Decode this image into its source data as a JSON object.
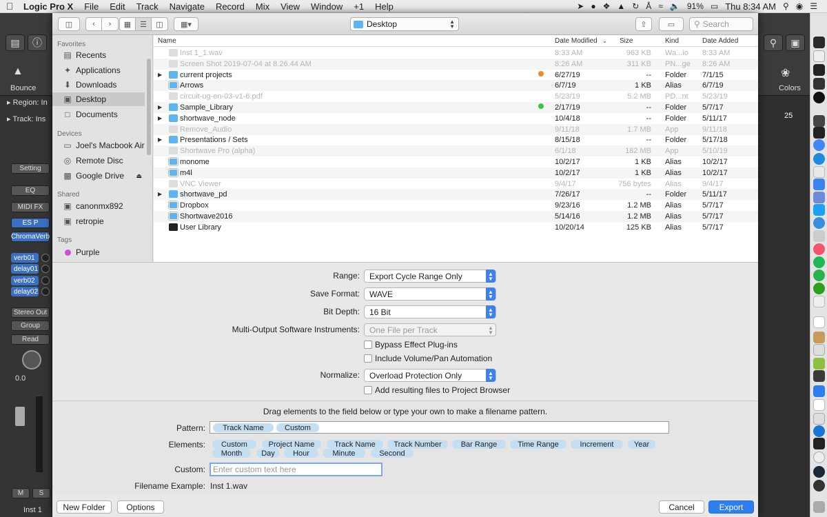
{
  "menubar": {
    "app": "Logic Pro X",
    "menus": [
      "File",
      "Edit",
      "Track",
      "Navigate",
      "Record",
      "Mix",
      "View",
      "Window",
      "+1",
      "Help"
    ],
    "battery": "91%",
    "clock": "Thu 8:34 AM"
  },
  "logic": {
    "bounce_label": "Bounce",
    "colors_label": "Colors",
    "region_label": "Region: In",
    "track_label": "Track: Ins",
    "ruler_value": "25",
    "setting_label": "Setting",
    "eq_label": "EQ",
    "midi_fx_label": "MIDI FX",
    "es_p_label": "ES P",
    "chromaverb_label": "ChromaVerb",
    "sends": [
      "verb01",
      "delay01",
      "verb02",
      "delay02"
    ],
    "stereo_out": "Stereo Out",
    "group_label": "Group",
    "read_label": "Read",
    "volume_value": "0.0",
    "mute_label": "M",
    "solo_label": "S",
    "channel_name": "Inst 1"
  },
  "dialog": {
    "location": "Desktop",
    "search_placeholder": "Search",
    "sidebar": {
      "favorites_header": "Favorites",
      "favorites": [
        {
          "label": "Recents",
          "icon": "recents-icon"
        },
        {
          "label": "Applications",
          "icon": "applications-icon"
        },
        {
          "label": "Downloads",
          "icon": "downloads-icon"
        },
        {
          "label": "Desktop",
          "icon": "desktop-icon"
        },
        {
          "label": "Documents",
          "icon": "documents-icon"
        }
      ],
      "devices_header": "Devices",
      "devices": [
        {
          "label": "Joel's Macbook Air",
          "icon": "laptop-icon"
        },
        {
          "label": "Remote Disc",
          "icon": "disc-icon"
        },
        {
          "label": "Google Drive",
          "icon": "drive-icon"
        }
      ],
      "shared_header": "Shared",
      "shared": [
        {
          "label": "canonmx892",
          "icon": "monitor-icon"
        },
        {
          "label": "retropie",
          "icon": "monitor-icon"
        }
      ],
      "tags_header": "Tags",
      "tags": [
        {
          "label": "Purple",
          "color": "#d14ed6"
        }
      ]
    },
    "columns": {
      "name": "Name",
      "date_modified": "Date Modified",
      "size": "Size",
      "kind": "Kind",
      "date_added": "Date Added"
    },
    "files": [
      {
        "name": "Inst 1_1.wav",
        "date_modified": "8:33 AM",
        "size": "963 KB",
        "kind": "Wa...io",
        "date_added": "8:33 AM",
        "icon": "doc",
        "dim": true
      },
      {
        "name": "Screen Shot 2019-07-04 at 8.26.44 AM",
        "date_modified": "8:26 AM",
        "size": "311 KB",
        "kind": "PN...ge",
        "date_added": "8:26 AM",
        "icon": "doc",
        "dim": true
      },
      {
        "name": "current projects",
        "date_modified": "6/27/19",
        "size": "--",
        "kind": "Folder",
        "date_added": "7/1/15",
        "icon": "folder",
        "expand": true,
        "tag": "#f08a24"
      },
      {
        "name": "Arrows",
        "date_modified": "6/7/19",
        "size": "1 KB",
        "kind": "Alias",
        "date_added": "6/7/19",
        "icon": "alias"
      },
      {
        "name": "circuit-ug-en-03-v1-6.pdf",
        "date_modified": "5/23/19",
        "size": "5.2 MB",
        "kind": "PD...nt",
        "date_added": "5/23/19",
        "icon": "doc",
        "dim": true
      },
      {
        "name": "Sample_Library",
        "date_modified": "2/17/19",
        "size": "--",
        "kind": "Folder",
        "date_added": "5/7/17",
        "icon": "folder",
        "expand": true,
        "tag": "#3ec43e"
      },
      {
        "name": "shortwave_node",
        "date_modified": "10/4/18",
        "size": "--",
        "kind": "Folder",
        "date_added": "5/11/17",
        "icon": "folder",
        "expand": true
      },
      {
        "name": "Remove_Audio",
        "date_modified": "9/11/18",
        "size": "1.7 MB",
        "kind": "App",
        "date_added": "9/11/18",
        "icon": "doc",
        "dim": true
      },
      {
        "name": "Presentations / Sets",
        "date_modified": "8/15/18",
        "size": "--",
        "kind": "Folder",
        "date_added": "5/17/18",
        "icon": "folder",
        "expand": true
      },
      {
        "name": "Shortwave Pro (alpha)",
        "date_modified": "6/1/18",
        "size": "182 MB",
        "kind": "App",
        "date_added": "5/10/19",
        "icon": "doc",
        "dim": true
      },
      {
        "name": "monome",
        "date_modified": "10/2/17",
        "size": "1 KB",
        "kind": "Alias",
        "date_added": "10/2/17",
        "icon": "alias"
      },
      {
        "name": "m4l",
        "date_modified": "10/2/17",
        "size": "1 KB",
        "kind": "Alias",
        "date_added": "10/2/17",
        "icon": "alias"
      },
      {
        "name": "VNC Viewer",
        "date_modified": "9/4/17",
        "size": "756 bytes",
        "kind": "Alias",
        "date_added": "9/4/17",
        "icon": "doc",
        "dim": true
      },
      {
        "name": "shortwave_pd",
        "date_modified": "7/26/17",
        "size": "--",
        "kind": "Folder",
        "date_added": "5/11/17",
        "icon": "folder",
        "expand": true
      },
      {
        "name": "Dropbox",
        "date_modified": "9/23/16",
        "size": "1.2 MB",
        "kind": "Alias",
        "date_added": "5/7/17",
        "icon": "alias"
      },
      {
        "name": "Shortwave2016",
        "date_modified": "5/14/16",
        "size": "1.2 MB",
        "kind": "Alias",
        "date_added": "5/7/17",
        "icon": "alias"
      },
      {
        "name": "User Library",
        "date_modified": "10/20/14",
        "size": "125 KB",
        "kind": "Alias",
        "date_added": "5/7/17",
        "icon": "termic"
      }
    ],
    "options": {
      "range_label": "Range:",
      "range_value": "Export Cycle Range Only",
      "save_format_label": "Save Format:",
      "save_format_value": "WAVE",
      "bit_depth_label": "Bit Depth:",
      "bit_depth_value": "16 Bit",
      "multi_output_label": "Multi-Output Software Instruments:",
      "multi_output_value": "One File per Track",
      "bypass_label": "Bypass Effect Plug-ins",
      "include_volpan_label": "Include Volume/Pan Automation",
      "normalize_label": "Normalize:",
      "normalize_value": "Overload Protection Only",
      "add_browser_label": "Add resulting files to Project Browser"
    },
    "pattern": {
      "hint": "Drag elements to the field below or type your own to make a filename pattern.",
      "pattern_label": "Pattern:",
      "pattern_tokens": [
        "Track Name",
        "Custom"
      ],
      "elements_label": "Elements:",
      "elements_row1": [
        "Custom",
        "Project Name",
        "Track Name",
        "Track Number",
        "Bar Range",
        "Time Range",
        "Increment",
        "Year"
      ],
      "elements_row2": [
        "Month",
        "Day",
        "Hour",
        "Minute",
        "Second"
      ],
      "custom_label": "Custom:",
      "custom_placeholder": "Enter custom text here",
      "filename_example_label": "Filename Example:",
      "filename_example_value": "Inst 1.wav"
    },
    "buttons": {
      "new_folder": "New Folder",
      "options": "Options",
      "cancel": "Cancel",
      "export": "Export"
    }
  }
}
